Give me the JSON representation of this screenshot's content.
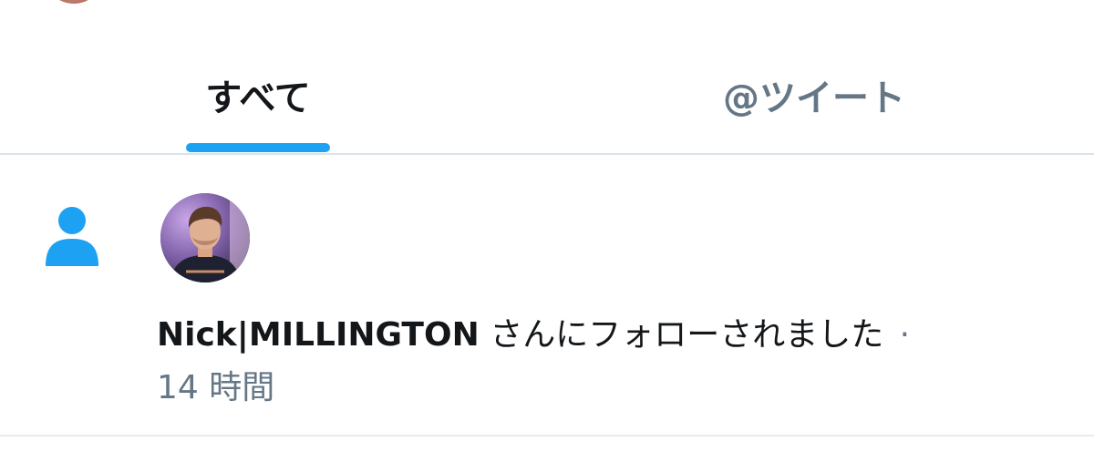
{
  "tabs": [
    {
      "label": "すべて",
      "active": true
    },
    {
      "label": "@ツイート",
      "active": false
    }
  ],
  "notification": {
    "type_icon": "person-icon",
    "avatar_icon": "user-avatar",
    "user_name": "Nick|MILLINGTON",
    "action_text": "さんにフォローされました",
    "separator": "·",
    "time": "14 時間"
  },
  "colors": {
    "accent": "#1da1f2",
    "primary_text": "#14171a",
    "secondary_text": "#657786",
    "divider": "#dbe3ea"
  }
}
